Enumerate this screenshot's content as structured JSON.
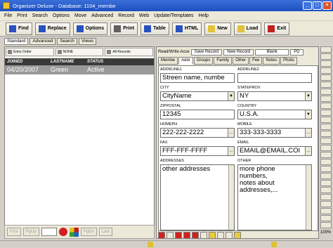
{
  "window": {
    "title": "Organizer Deluxe - Database: 1104_membe"
  },
  "menu": [
    "File",
    "Print",
    "Search",
    "Options",
    "Move",
    "Advanced",
    "Record",
    "Web",
    "Update/Templates",
    "Help"
  ],
  "toolbar": [
    "Find",
    "Replace",
    "Options",
    "Print",
    "Table",
    "HTML",
    "New",
    "Load",
    "Exit"
  ],
  "subtabs": [
    "Standard",
    "Advanced",
    "Search",
    "Views"
  ],
  "sort": {
    "btn1": "Entry Order",
    "btn2": "NONE",
    "btn3": "All Records"
  },
  "list": {
    "headers": [
      "JOINED",
      "LASTNAME",
      "STATUS"
    ],
    "row": [
      "04/20/2007",
      "Green",
      "Active"
    ]
  },
  "leftnav": {
    "first": "First",
    "pgup": "PgUp",
    "pgdn": "PgDn",
    "last": "Last"
  },
  "rw": {
    "label": "Read/Write Acce",
    "save": "Save Record",
    "new": "New Record",
    "blank": "Blank",
    "pd": "PD"
  },
  "rtabs": [
    "Membe",
    "Addr",
    "Groups",
    "Family",
    "Other",
    "Fee",
    "Notes",
    "Photo"
  ],
  "fields": {
    "addr1_label": "ADDRLINE1",
    "addr1": "Streen name, numbe",
    "addr2_label": "ADDRLINE2",
    "addr2": "",
    "city_label": "CITY",
    "city": "CityName",
    "state_label": "STATEPROV",
    "state": "NY",
    "zip_label": "ZIPPOSTAL",
    "zip": "12345",
    "country_label": "COUNTRY",
    "country": "U.S.A.",
    "home_label": "HOMEPH",
    "home": "222-222-2222",
    "mobile_label": "MOBILE",
    "mobile": "333-333-3333",
    "fax_label": "FAX",
    "fax": "FFF-FFF-FFFF",
    "email_label": "EMAIL",
    "email": "EMAIL@EMAIL.COI",
    "addresses_label": "ADDRESSES",
    "addresses": "other addresses",
    "other_label": "OTHER",
    "other": "more phone\nnumbers,\nnotes about\naddresses,..."
  },
  "zoom": "100%"
}
